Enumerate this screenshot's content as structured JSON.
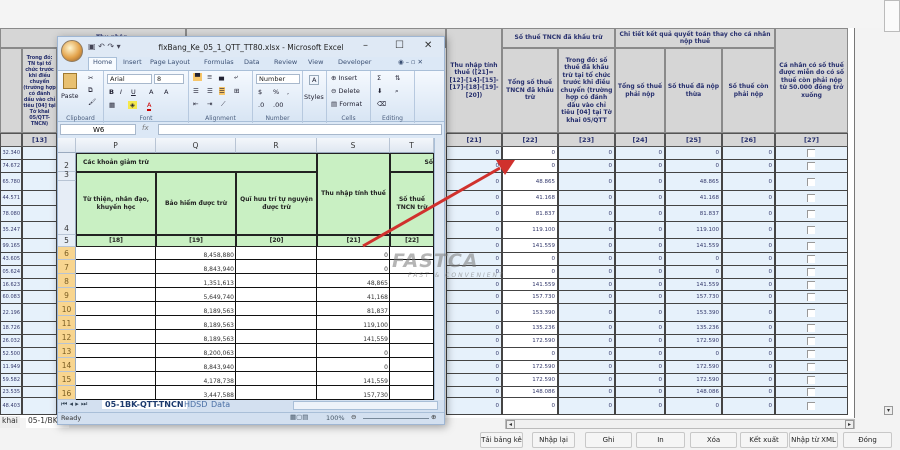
{
  "background_form": {
    "left_group_header": "Thu nhập",
    "left_col_header": "Trong đó: TN tại tổ chức trước khi điều chuyển (trường hợp có đánh dấu vào chỉ tiêu [04] tại Tờ khai 05/QTT-TNCN)",
    "left_col_index": "[13]",
    "left_values": [
      "32.340",
      "74.672",
      "65.780",
      "44.571",
      "78.080",
      "35.247",
      "99.165",
      "43.605",
      "05.624",
      "16.623",
      "60.083",
      "22.196",
      "18.726",
      "26.032",
      "52.500",
      "11.949",
      "59.582",
      "23.535",
      "48.403"
    ],
    "group_headers": {
      "withheld": "Số thuế TNCN đã khấu trừ",
      "settlement": "Chi tiết kết quả quyết toán thay cho cá nhân nộp thuế"
    },
    "columns": [
      {
        "index": "[21]",
        "header": "Thu nhập tính thuế ([21]=[12]-[14]-[15]-[17]-[18]-[19]-[20])"
      },
      {
        "index": "[22]",
        "header": "Tổng số thuế TNCN đã khấu trừ"
      },
      {
        "index": "[23]",
        "header": "Trong đó: số thuế đã khấu trừ tại tổ chức trước khi điều chuyển (trường hợp có đánh dấu vào chỉ tiêu [04] tại Tờ khai 05/QTT"
      },
      {
        "index": "[24]",
        "header": "Tổng số thuế phải nộp"
      },
      {
        "index": "[25]",
        "header": "Số thuế đã nộp thừa"
      },
      {
        "index": "[26]",
        "header": "Số thuế còn phải nộp"
      },
      {
        "index": "[27]",
        "header": "Cá nhân có số thuế được miễn do có số thuế còn phải nộp từ 50.000 đồng trở xuống"
      }
    ],
    "rows": [
      [
        "0",
        "0",
        "0",
        "0",
        "0",
        "0",
        false
      ],
      [
        "0",
        "0",
        "0",
        "0",
        "0",
        "0",
        false
      ],
      [
        "0",
        "48.865",
        "0",
        "0",
        "48.865",
        "0",
        false
      ],
      [
        "0",
        "41.168",
        "0",
        "0",
        "41.168",
        "0",
        false
      ],
      [
        "0",
        "81.837",
        "0",
        "0",
        "81.837",
        "0",
        false
      ],
      [
        "0",
        "119.100",
        "0",
        "0",
        "119.100",
        "0",
        false
      ],
      [
        "0",
        "141.559",
        "0",
        "0",
        "141.559",
        "0",
        false
      ],
      [
        "0",
        "0",
        "0",
        "0",
        "0",
        "0",
        false
      ],
      [
        "0",
        "0",
        "0",
        "0",
        "0",
        "0",
        false
      ],
      [
        "0",
        "141.559",
        "0",
        "0",
        "141.559",
        "0",
        false
      ],
      [
        "0",
        "157.730",
        "0",
        "0",
        "157.730",
        "0",
        false
      ],
      [
        "0",
        "153.390",
        "0",
        "0",
        "153.390",
        "0",
        false
      ],
      [
        "0",
        "135.236",
        "0",
        "0",
        "135.236",
        "0",
        false
      ],
      [
        "0",
        "172.590",
        "0",
        "0",
        "172.590",
        "0",
        false
      ],
      [
        "0",
        "0",
        "0",
        "0",
        "0",
        "0",
        false
      ],
      [
        "0",
        "172.590",
        "0",
        "0",
        "172.590",
        "0",
        false
      ],
      [
        "0",
        "172.590",
        "0",
        "0",
        "172.590",
        "0",
        false
      ],
      [
        "0",
        "148.086",
        "0",
        "0",
        "148.086",
        "0",
        false
      ],
      [
        "0",
        "0",
        "0",
        "0",
        "0",
        "0",
        false
      ]
    ],
    "bottom_tabs": [
      "khai",
      "05-1/BK-..."
    ],
    "buttons": [
      "Tải bảng kê",
      "Nhập lại",
      "Ghi",
      "In",
      "Xóa",
      "Kết xuất",
      "Nhập từ XML",
      "Đóng"
    ]
  },
  "excel": {
    "title": "fixBang_Ke_05_1_QTT_TT80.xlsx - Microsoft Excel",
    "ribbon_tabs": [
      "Home",
      "Insert",
      "Page Layout",
      "Formulas",
      "Data",
      "Review",
      "View",
      "Developer"
    ],
    "font_name": "Arial",
    "font_size": "8",
    "number_format": "Number",
    "paste_label": "Paste",
    "styles_label": "Styles",
    "cells_items": [
      "Insert",
      "Delete",
      "Format"
    ],
    "group_labels": [
      "Clipboard",
      "Font",
      "Alignment",
      "Number",
      "Cells",
      "Editing"
    ],
    "name_box": "W6",
    "fx_label": "fx",
    "columns": [
      "P",
      "Q",
      "R",
      "S",
      "T"
    ],
    "header_rows": {
      "group": "Các khoản giảm trừ",
      "group_t": "Số",
      "headers": [
        "Từ thiện, nhân đạo, khuyến học",
        "Bảo hiểm được trừ",
        "Quĩ hưu trí tự nguyện được trừ",
        "Thu nhập tính thuế",
        "Số thuế TNCN trừ"
      ],
      "indices": [
        "[18]",
        "[19]",
        "[20]",
        "[21]",
        "[22]"
      ]
    },
    "row_numbers": [
      "2",
      "3",
      "4",
      "5",
      "6",
      "7",
      "8",
      "9",
      "10",
      "11",
      "12",
      "13",
      "14",
      "15",
      "16"
    ],
    "data_rows": [
      {
        "q": "8,458,880",
        "s": "0"
      },
      {
        "q": "8,843,940",
        "s": "0"
      },
      {
        "q": "1,351,613",
        "s": "48,865"
      },
      {
        "q": "5,649,740",
        "s": "41,168"
      },
      {
        "q": "8,189,563",
        "s": "81,837"
      },
      {
        "q": "8,189,563",
        "s": "119,100"
      },
      {
        "q": "8,189,563",
        "s": "141,559"
      },
      {
        "q": "8,200,063",
        "s": "0"
      },
      {
        "q": "8,843,940",
        "s": "0"
      },
      {
        "q": "4,178,738",
        "s": "141,559"
      },
      {
        "q": "3,447,588",
        "s": "157,730"
      }
    ],
    "sheet_tabs": [
      "05-1BK-QTT-TNCN",
      "HDSD",
      "Data"
    ],
    "status": "Ready",
    "zoom": "100%"
  },
  "watermark": {
    "brand": "FASTCA",
    "tagline": "FAST & CONVENIENT"
  },
  "colors": {
    "arrow": "#d0312d",
    "excel_header_green": "#c9f0c3",
    "selected_row_header": "#f8d58f",
    "form_cell": "#e6f1fb",
    "form_header": "#d6d6d6"
  }
}
